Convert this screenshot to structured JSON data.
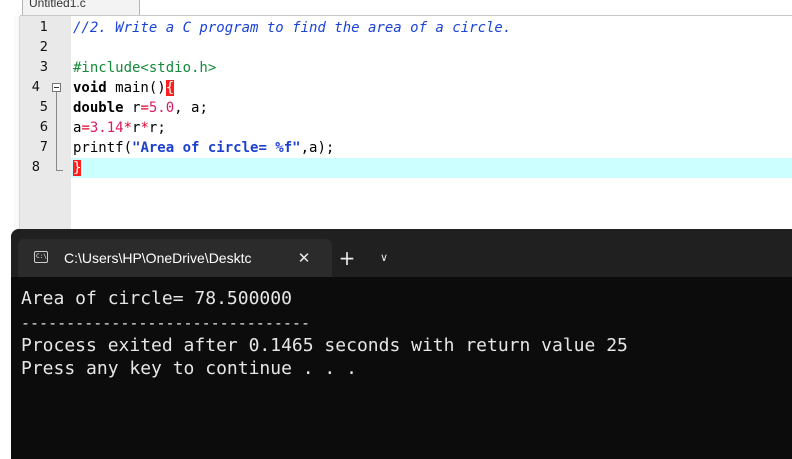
{
  "editor": {
    "tab_label": "Untitled1.c",
    "line_numbers": [
      "1",
      "2",
      "3",
      "4",
      "5",
      "6",
      "7",
      "8"
    ],
    "lines": {
      "l1_comment": "//2. Write a C program to find the area of a circle.",
      "l3_include": "#include<stdio.h>",
      "l4_kw": "void",
      "l4_rest": " main()",
      "l4_brace": "{",
      "l5_kw": "double",
      "l5_a": " r",
      "l5_eq": "=",
      "l5_num": "5.0",
      "l5_b": ", a;",
      "l6_a": "a",
      "l6_eq": "=",
      "l6_num": "3.14",
      "l6_op1": "*",
      "l6_r1": "r",
      "l6_op2": "*",
      "l6_r2": "r;",
      "l7_fn": "printf(",
      "l7_str": "\"Area of circle= %f\"",
      "l7_rest": ",a);",
      "l8_brace": "}"
    }
  },
  "terminal": {
    "tab_icon_text": "C:\\",
    "tab_title": "C:\\Users\\HP\\OneDrive\\Desktc",
    "close_glyph": "✕",
    "new_tab_glyph": "+",
    "dropdown_glyph": "∨",
    "output": [
      "Area of circle= 78.500000",
      "--------------------------------",
      "Process exited after 0.1465 seconds with return value 25",
      "Press any key to continue . . ."
    ]
  }
}
